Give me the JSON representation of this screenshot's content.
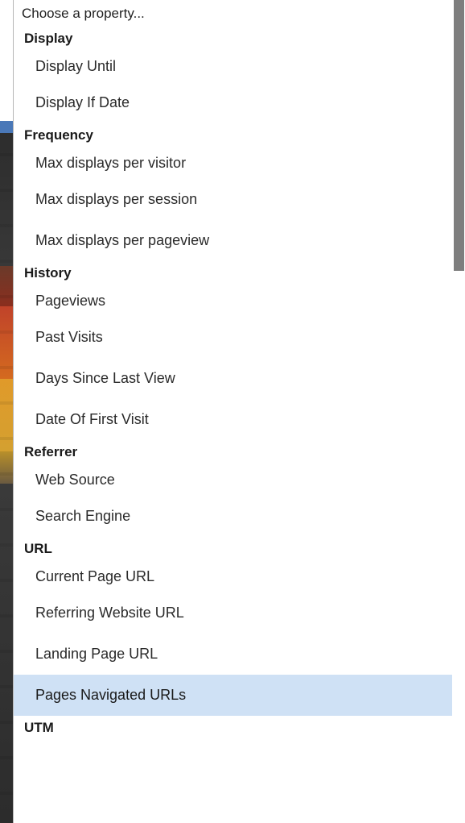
{
  "placeholder": "Choose a property...",
  "groups": [
    {
      "label": "Display",
      "options": [
        "Display Until",
        "Display If Date"
      ]
    },
    {
      "label": "Frequency",
      "options": [
        "Max displays per visitor",
        "Max displays per session",
        "Max displays per pageview"
      ]
    },
    {
      "label": "History",
      "options": [
        "Pageviews",
        "Past Visits",
        "Days Since Last View",
        "Date Of First Visit"
      ]
    },
    {
      "label": "Referrer",
      "options": [
        "Web Source",
        "Search Engine"
      ]
    },
    {
      "label": "URL",
      "options": [
        "Current Page URL",
        "Referring Website URL",
        "Landing Page URL",
        "Pages Navigated URLs"
      ]
    },
    {
      "label": "UTM",
      "options": []
    }
  ],
  "highlighted_option": "Pages Navigated URLs",
  "colors": {
    "highlight": "#cfe1f5",
    "scroll_thumb": "#7e7e7e",
    "border": "#b7b7b7"
  }
}
